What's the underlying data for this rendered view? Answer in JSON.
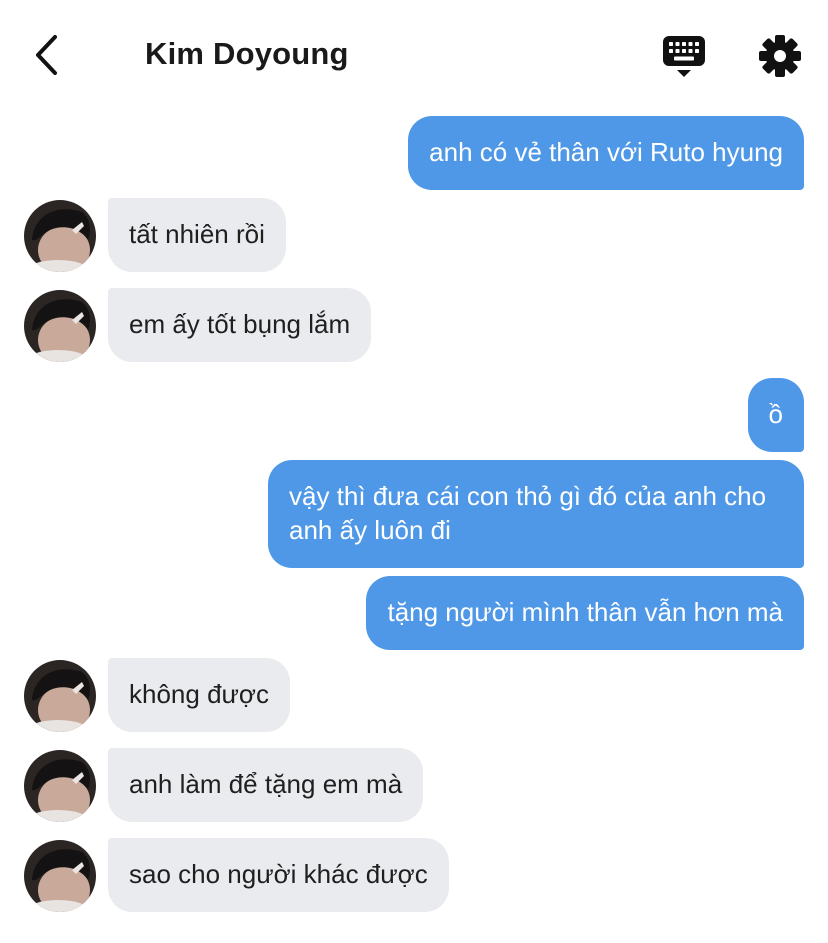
{
  "header": {
    "back_icon": "chevron-left-icon",
    "title": "Kim Doyoung",
    "keyboard_icon": "keyboard-icon",
    "settings_icon": "gear-icon"
  },
  "colors": {
    "outgoing_bubble": "#4f98e7",
    "incoming_bubble": "#e9ebee",
    "text_dark": "#1f1f1f"
  },
  "messages": [
    {
      "side": "out",
      "text": "anh có vẻ thân với Ruto hyung"
    },
    {
      "side": "in",
      "text": "tất nhiên rồi"
    },
    {
      "side": "in",
      "text": "em ấy tốt bụng lắm"
    },
    {
      "side": "out",
      "text": "ồ"
    },
    {
      "side": "out",
      "text": "vậy thì đưa cái con thỏ gì đó của anh cho anh ấy luôn đi"
    },
    {
      "side": "out",
      "text": "tặng người mình thân vẫn hơn mà"
    },
    {
      "side": "in",
      "text": "không được"
    },
    {
      "side": "in",
      "text": "anh làm để tặng em mà"
    },
    {
      "side": "in",
      "text": "sao cho người khác được"
    }
  ]
}
